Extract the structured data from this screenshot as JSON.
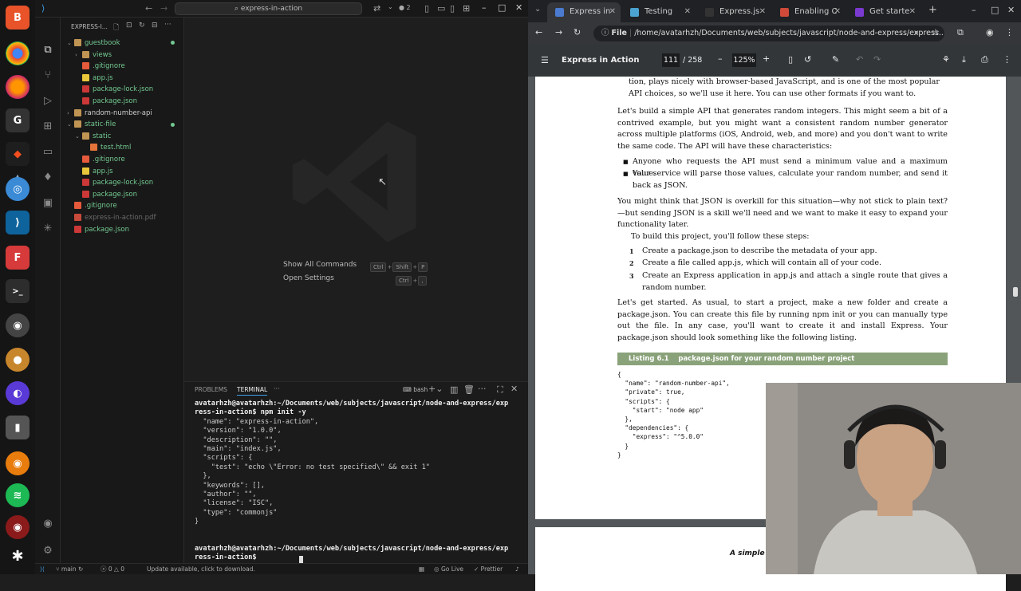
{
  "vscode": {
    "title_search": "express-in-action",
    "badge": "2",
    "explorer_title": "EXPRESS-I...",
    "tree": [
      {
        "label": "guestbook",
        "kind": "folder-open",
        "depth": 0,
        "color": "#73c991"
      },
      {
        "label": "views",
        "kind": "folder",
        "depth": 1,
        "color": "#73c991"
      },
      {
        "label": ".gitignore",
        "kind": "git",
        "depth": 1,
        "color": "#73c991"
      },
      {
        "label": "app.js",
        "kind": "js",
        "depth": 1,
        "color": "#73c991"
      },
      {
        "label": "package-lock.json",
        "kind": "npm",
        "depth": 1,
        "color": "#73c991"
      },
      {
        "label": "package.json",
        "kind": "npm",
        "depth": 1,
        "color": "#73c991"
      },
      {
        "label": "random-number-api",
        "kind": "folder",
        "depth": 0,
        "color": "#cccccc"
      },
      {
        "label": "static-file",
        "kind": "folder-open",
        "depth": 0,
        "color": "#73c991"
      },
      {
        "label": "static",
        "kind": "folder-open",
        "depth": 1,
        "color": "#73c991"
      },
      {
        "label": "test.html",
        "kind": "html",
        "depth": 2,
        "color": "#73c991"
      },
      {
        "label": ".gitignore",
        "kind": "git",
        "depth": 1,
        "color": "#73c991"
      },
      {
        "label": "app.js",
        "kind": "js",
        "depth": 1,
        "color": "#73c991"
      },
      {
        "label": "package-lock.json",
        "kind": "npm",
        "depth": 1,
        "color": "#73c991"
      },
      {
        "label": "package.json",
        "kind": "npm",
        "depth": 1,
        "color": "#73c991"
      },
      {
        "label": ".gitignore",
        "kind": "git",
        "depth": 0,
        "color": "#73c991"
      },
      {
        "label": "express-in-action.pdf",
        "kind": "pdf",
        "depth": 0,
        "color": "#6a6a6a"
      },
      {
        "label": "package.json",
        "kind": "npm",
        "depth": 0,
        "color": "#73c991"
      }
    ],
    "welcome": {
      "show_commands": "Show All Commands",
      "show_keys": [
        "Ctrl",
        "+",
        "Shift",
        "+",
        "P"
      ],
      "open_settings": "Open Settings",
      "settings_keys": [
        "Ctrl",
        "+",
        ","
      ]
    },
    "panel_tabs": {
      "problems": "PROBLEMS",
      "terminal": "TERMINAL",
      "more": "···",
      "shell": "bash"
    },
    "terminal": [
      {
        "t": "avatarhzh@avatarhzh:~/Documents/web/subjects/javascript/node-and-express/exp",
        "prompt": true
      },
      {
        "t": "ress-in-action$ npm init -y",
        "prompt": true
      },
      {
        "t": "  \"name\": \"express-in-action\","
      },
      {
        "t": "  \"version\": \"1.0.0\","
      },
      {
        "t": "  \"description\": \"\","
      },
      {
        "t": "  \"main\": \"index.js\","
      },
      {
        "t": "  \"scripts\": {"
      },
      {
        "t": "    \"test\": \"echo \\\"Error: no test specified\\\" && exit 1\""
      },
      {
        "t": "  },"
      },
      {
        "t": "  \"keywords\": [],"
      },
      {
        "t": "  \"author\": \"\","
      },
      {
        "t": "  \"license\": \"ISC\","
      },
      {
        "t": "  \"type\": \"commonjs\""
      },
      {
        "t": "}"
      },
      {
        "t": ""
      },
      {
        "t": "avatarhzh@avatarhzh:~/Documents/web/subjects/javascript/node-and-express/exp",
        "prompt": true
      },
      {
        "t": "ress-in-action$ ",
        "prompt": true
      }
    ],
    "status": {
      "branch": "main",
      "errors": "0",
      "warnings": "0",
      "update": "Update available, click to download.",
      "golive": "Go Live",
      "prettier": "Prettier"
    }
  },
  "browser": {
    "tabs": [
      {
        "label": "Express in",
        "active": true,
        "fav": "#4a7bd0"
      },
      {
        "label": "Testing",
        "active": false,
        "fav": "#4aa3d0"
      },
      {
        "label": "Express.js",
        "active": false,
        "fav": "#333333"
      },
      {
        "label": "Enabling C",
        "active": false,
        "fav": "#d04a3a"
      },
      {
        "label": "Get starte",
        "active": false,
        "fav": "#7a3ad0"
      }
    ],
    "new_tab": "+",
    "file_chip": "File",
    "url": "/home/avatarhzh/Documents/web/subjects/javascript/node-and-express/express...",
    "pdf": {
      "title": "Express in Action",
      "page": "111",
      "total": "/ 258",
      "zoom": "125%"
    },
    "page_text": {
      "p0": "tion, plays nicely with browser-based JavaScript, and is one of the most popular API choices, so we'll use it here. You can use other formats if you want to.",
      "p1": "Let's build a simple API that generates random integers. This might seem a bit of a contrived example, but you might want a consistent random number generator across multiple platforms (iOS, Android, web, and more) and you don't want to write the same code. The API will have these characteristics:",
      "b1": "Anyone who requests the API must send a minimum value and a maximum value.",
      "b2": "Your service will parse those values, calculate your random number, and send it back as JSON.",
      "p2": "You might think that JSON is overkill for this situation—why not stick to plain text?—but sending JSON is a skill we'll need and we want to make it easy to expand your functionality later.",
      "p3": "To build this project, you'll follow these steps:",
      "s1n": "1",
      "s1": "Create a package.json to describe the metadata of your app.",
      "s2n": "2",
      "s2": "Create a file called app.js, which will contain all of your code.",
      "s3n": "3",
      "s3": "Create an Express application in app.js and attach a single route that gives a random number.",
      "p4": "Let's get started. As usual, to start a project, make a new folder and create a package.json. You can create this file by running npm init or you can manually type out the file. In any case, you'll want to create it and install Express. Your package.json should look something like the following listing.",
      "listing": "Listing 6.1    package.json for your random number project",
      "code": "{\n  \"name\": \"random-number-api\",\n  \"private\": true,\n  \"scripts\": {\n    \"start\": \"node app\"\n  },\n  \"dependencies\": {\n    \"express\": \"^5.0.0\"\n  }\n}",
      "next_page": "A simple E"
    }
  }
}
